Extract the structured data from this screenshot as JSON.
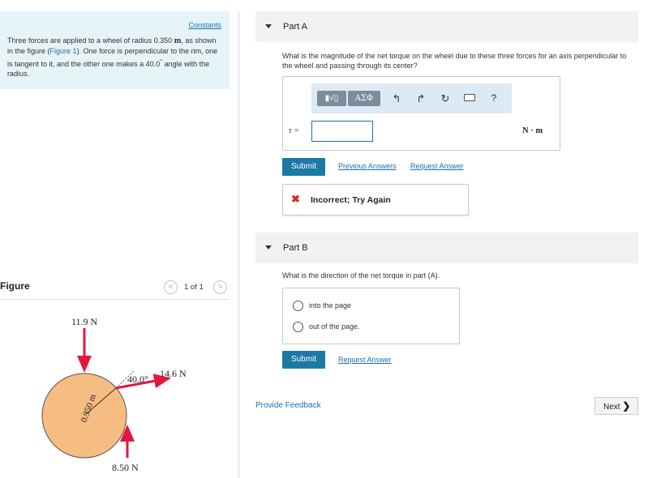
{
  "problem": {
    "constants_link": "Constants",
    "intro_before_radius": "Three forces are applied to a wheel of radius 0.350",
    "radius_unit": "m",
    "intro_mid1": ", as shown in the figure (",
    "figure_link": "Figure 1",
    "intro_mid2": "). One force is perpendicular to the rim, one is tangent to it, and the other one makes a 40.0",
    "degree": "°",
    "intro_end": " angle with the radius."
  },
  "figure": {
    "label": "Figure",
    "pager_prev": "<",
    "pager_text": "1 of 1",
    "pager_next": ">",
    "force_top": "11.9 N",
    "force_right": "14.6 N",
    "force_bottom": "8.50 N",
    "angle": "40.0°",
    "radius_label": "0.350 m",
    "wheel_color": "#f5bd82",
    "arrow_color": "#e3173e"
  },
  "part_a": {
    "title": "Part A",
    "question": "What is the magnitude of the net torque on the wheel due to these three forces for an axis perpendicular to the wheel and passing through its center?",
    "toolbar": {
      "templates": "▮√▯",
      "greek": "ΑΣΦ",
      "undo": "↰",
      "redo": "↱",
      "reset": "↻",
      "help": "?"
    },
    "var_label": "τ =",
    "input_value": "",
    "unit": "N · m",
    "submit": "Submit",
    "previous_answers": "Previous Answers",
    "request_answer": "Request Answer",
    "feedback": "Incorrect; Try Again"
  },
  "part_b": {
    "title": "Part B",
    "question": "What is the direction of the net torque in part (A).",
    "options": [
      "into the page",
      "out of the page."
    ],
    "submit": "Submit",
    "request_answer": "Request Answer"
  },
  "footer": {
    "provide_feedback": "Provide Feedback",
    "next": "Next",
    "next_icon": "❯"
  }
}
